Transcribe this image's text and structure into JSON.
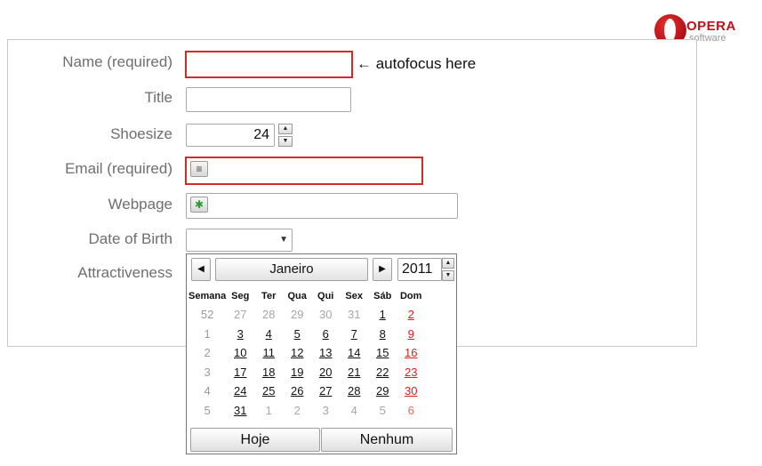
{
  "logo": {
    "word": "OPERA",
    "sub": "software"
  },
  "form": {
    "name_label": "Name (required)",
    "title_label": "Title",
    "shoesize_label": "Shoesize",
    "shoesize_value": "24",
    "email_label": "Email (required)",
    "webpage_label": "Webpage",
    "dob_label": "Date of Birth",
    "attractiveness_label": "Attractiveness",
    "autofocus_hint": "← autofocus here"
  },
  "colors": {
    "required_border": "#d42a2a",
    "sunday": "#d42020"
  },
  "calendar": {
    "month": "Janeiro",
    "year": "2011",
    "week_header": "Semana",
    "day_headers": [
      "Seg",
      "Ter",
      "Qua",
      "Qui",
      "Sex",
      "Sáb",
      "Dom"
    ],
    "weeks": [
      {
        "num": "52",
        "days": [
          {
            "d": "27",
            "c": false
          },
          {
            "d": "28",
            "c": false
          },
          {
            "d": "29",
            "c": false
          },
          {
            "d": "30",
            "c": false
          },
          {
            "d": "31",
            "c": false
          },
          {
            "d": "1",
            "c": true
          },
          {
            "d": "2",
            "c": true
          }
        ]
      },
      {
        "num": "1",
        "days": [
          {
            "d": "3",
            "c": true
          },
          {
            "d": "4",
            "c": true
          },
          {
            "d": "5",
            "c": true
          },
          {
            "d": "6",
            "c": true
          },
          {
            "d": "7",
            "c": true
          },
          {
            "d": "8",
            "c": true
          },
          {
            "d": "9",
            "c": true
          }
        ]
      },
      {
        "num": "2",
        "days": [
          {
            "d": "10",
            "c": true
          },
          {
            "d": "11",
            "c": true
          },
          {
            "d": "12",
            "c": true
          },
          {
            "d": "13",
            "c": true
          },
          {
            "d": "14",
            "c": true
          },
          {
            "d": "15",
            "c": true
          },
          {
            "d": "16",
            "c": true
          }
        ]
      },
      {
        "num": "3",
        "days": [
          {
            "d": "17",
            "c": true
          },
          {
            "d": "18",
            "c": true
          },
          {
            "d": "19",
            "c": true
          },
          {
            "d": "20",
            "c": true
          },
          {
            "d": "21",
            "c": true
          },
          {
            "d": "22",
            "c": true
          },
          {
            "d": "23",
            "c": true
          }
        ]
      },
      {
        "num": "4",
        "days": [
          {
            "d": "24",
            "c": true
          },
          {
            "d": "25",
            "c": true
          },
          {
            "d": "26",
            "c": true
          },
          {
            "d": "27",
            "c": true
          },
          {
            "d": "28",
            "c": true
          },
          {
            "d": "29",
            "c": true
          },
          {
            "d": "30",
            "c": true
          }
        ]
      },
      {
        "num": "5",
        "days": [
          {
            "d": "31",
            "c": true
          },
          {
            "d": "1",
            "c": false
          },
          {
            "d": "2",
            "c": false
          },
          {
            "d": "3",
            "c": false
          },
          {
            "d": "4",
            "c": false
          },
          {
            "d": "5",
            "c": false
          },
          {
            "d": "6",
            "c": false
          }
        ]
      }
    ],
    "today_label": "Hoje",
    "none_label": "Nenhum"
  }
}
